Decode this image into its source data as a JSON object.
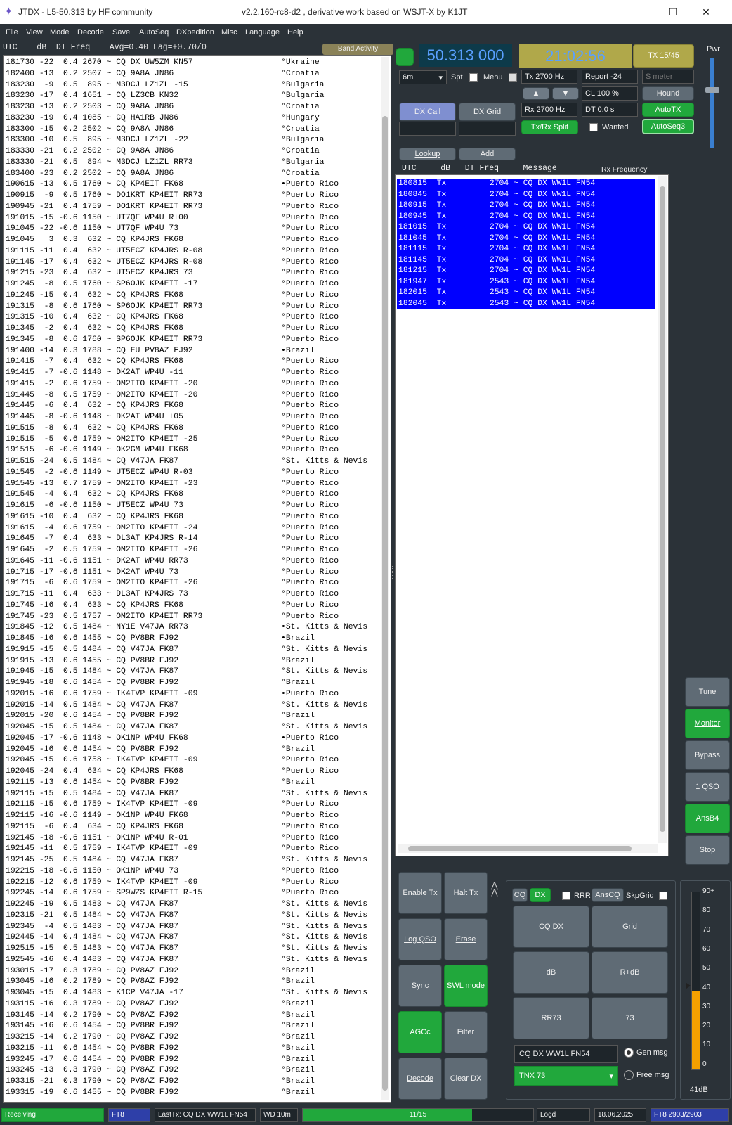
{
  "window": {
    "title": "JTDX - L5-50.313  by HF community",
    "version_text": "v2.2.160-rc8-d2 , derivative work based on WSJT-X by K1JT",
    "minimize": "—",
    "maximize": "☐",
    "close": "✕"
  },
  "menu": [
    "File",
    "View",
    "Mode",
    "Decode",
    "Save",
    "AutoSeq",
    "DXpedition",
    "Misc",
    "Language",
    "Help"
  ],
  "band_activity": {
    "header": "UTC    dB  DT Freq    Avg=0.40 Lag=+0.70/0",
    "button": "Band Activity",
    "rows": [
      [
        "181730 -22  0.4 2670 ~ CQ DX UW5ZM KN57",
        "°Ukraine"
      ],
      [
        "182400 -13  0.2 2507 ~ CQ 9A8A JN86",
        "°Croatia"
      ],
      [
        "183230  -9  0.5  895 ~ M3DCJ LZ1ZL -15",
        "°Bulgaria"
      ],
      [
        "183230 -17  0.4 1651 ~ CQ LZ3CB KN32",
        "°Bulgaria"
      ],
      [
        "183230 -13  0.2 2503 ~ CQ 9A8A JN86",
        "°Croatia"
      ],
      [
        "183230 -19  0.4 1085 ~ CQ HA1RB JN86",
        "°Hungary"
      ],
      [
        "183300 -15  0.2 2502 ~ CQ 9A8A JN86",
        "°Croatia"
      ],
      [
        "183300 -10  0.5  895 ~ M3DCJ LZ1ZL -22",
        "°Bulgaria"
      ],
      [
        "183330 -21  0.2 2502 ~ CQ 9A8A JN86",
        "°Croatia"
      ],
      [
        "183330 -21  0.5  894 ~ M3DCJ LZ1ZL RR73",
        "°Bulgaria"
      ],
      [
        "183400 -23  0.2 2502 ~ CQ 9A8A JN86",
        "°Croatia"
      ],
      [
        "190615 -13  0.5 1760 ~ CQ KP4EIT FK68",
        "•Puerto Rico"
      ],
      [
        "190915  -9  0.5 1760 ~ DO1KRT KP4EIT RR73",
        "°Puerto Rico"
      ],
      [
        "190945 -21  0.4 1759 ~ DO1KRT KP4EIT RR73",
        "°Puerto Rico"
      ],
      [
        "191015 -15 -0.6 1150 ~ UT7QF WP4U R+00",
        "°Puerto Rico"
      ],
      [
        "191045 -22 -0.6 1150 ~ UT7QF WP4U 73",
        "°Puerto Rico"
      ],
      [
        "191045   3  0.3  632 ~ CQ KP4JRS FK68",
        "°Puerto Rico"
      ],
      [
        "191115 -11  0.4  632 ~ UT5ECZ KP4JRS R-08",
        "°Puerto Rico"
      ],
      [
        "191145 -17  0.4  632 ~ UT5ECZ KP4JRS R-08",
        "°Puerto Rico"
      ],
      [
        "191215 -23  0.4  632 ~ UT5ECZ KP4JRS 73",
        "°Puerto Rico"
      ],
      [
        "191245  -8  0.5 1760 ~ SP6OJK KP4EIT -17",
        "°Puerto Rico"
      ],
      [
        "191245 -15  0.4  632 ~ CQ KP4JRS FK68",
        "°Puerto Rico"
      ],
      [
        "191315  -8  0.6 1760 ~ SP6OJK KP4EIT RR73",
        "°Puerto Rico"
      ],
      [
        "191315 -10  0.4  632 ~ CQ KP4JRS FK68",
        "°Puerto Rico"
      ],
      [
        "191345  -2  0.4  632 ~ CQ KP4JRS FK68",
        "°Puerto Rico"
      ],
      [
        "191345  -8  0.6 1760 ~ SP6OJK KP4EIT RR73",
        "°Puerto Rico"
      ],
      [
        "191400 -14  0.3 1788 ~ CQ EU PV8AZ FJ92",
        "•Brazil"
      ],
      [
        "191415  -7  0.4  632 ~ CQ KP4JRS FK68",
        "°Puerto Rico"
      ],
      [
        "191415  -7 -0.6 1148 ~ DK2AT WP4U -11",
        "°Puerto Rico"
      ],
      [
        "191415  -2  0.6 1759 ~ OM2ITO KP4EIT -20",
        "°Puerto Rico"
      ],
      [
        "191445  -8  0.5 1759 ~ OM2ITO KP4EIT -20",
        "°Puerto Rico"
      ],
      [
        "191445  -6  0.4  632 ~ CQ KP4JRS FK68",
        "°Puerto Rico"
      ],
      [
        "191445  -8 -0.6 1148 ~ DK2AT WP4U +05",
        "°Puerto Rico"
      ],
      [
        "191515  -8  0.4  632 ~ CQ KP4JRS FK68",
        "°Puerto Rico"
      ],
      [
        "191515  -5  0.6 1759 ~ OM2ITO KP4EIT -25",
        "°Puerto Rico"
      ],
      [
        "191515  -6 -0.6 1149 ~ OK2GM WP4U FK68",
        "°Puerto Rico"
      ],
      [
        "191515 -24  0.5 1484 ~ CQ V47JA FK87",
        "°St. Kitts & Nevis"
      ],
      [
        "191545  -2 -0.6 1149 ~ UT5ECZ WP4U R-03",
        "°Puerto Rico"
      ],
      [
        "191545 -13  0.7 1759 ~ OM2ITO KP4EIT -23",
        "°Puerto Rico"
      ],
      [
        "191545  -4  0.4  632 ~ CQ KP4JRS FK68",
        "°Puerto Rico"
      ],
      [
        "191615  -6 -0.6 1150 ~ UT5ECZ WP4U 73",
        "°Puerto Rico"
      ],
      [
        "191615 -10  0.4  632 ~ CQ KP4JRS FK68",
        "°Puerto Rico"
      ],
      [
        "191615  -4  0.6 1759 ~ OM2ITO KP4EIT -24",
        "°Puerto Rico"
      ],
      [
        "191645  -7  0.4  633 ~ DL3AT KP4JRS R-14",
        "°Puerto Rico"
      ],
      [
        "191645  -2  0.5 1759 ~ OM2ITO KP4EIT -26",
        "°Puerto Rico"
      ],
      [
        "191645 -11 -0.6 1151 ~ DK2AT WP4U RR73",
        "°Puerto Rico"
      ],
      [
        "191715 -17 -0.6 1151 ~ DK2AT WP4U 73",
        "°Puerto Rico"
      ],
      [
        "191715  -6  0.6 1759 ~ OM2ITO KP4EIT -26",
        "°Puerto Rico"
      ],
      [
        "191715 -11  0.4  633 ~ DL3AT KP4JRS 73",
        "°Puerto Rico"
      ],
      [
        "191745 -16  0.4  633 ~ CQ KP4JRS FK68",
        "°Puerto Rico"
      ],
      [
        "191745 -23  0.5 1757 ~ OM2ITO KP4EIT RR73",
        "°Puerto Rico"
      ],
      [
        "191845 -12  0.5 1484 ~ NY1E V47JA RR73",
        "•St. Kitts & Nevis"
      ],
      [
        "191845 -16  0.6 1455 ~ CQ PV8BR FJ92",
        "•Brazil"
      ],
      [
        "191915 -15  0.5 1484 ~ CQ V47JA FK87",
        "°St. Kitts & Nevis"
      ],
      [
        "191915 -13  0.6 1455 ~ CQ PV8BR FJ92",
        "°Brazil"
      ],
      [
        "191945 -15  0.5 1484 ~ CQ V47JA FK87",
        "°St. Kitts & Nevis"
      ],
      [
        "191945 -18  0.6 1454 ~ CQ PV8BR FJ92",
        "°Brazil"
      ],
      [
        "192015 -16  0.6 1759 ~ IK4TVP KP4EIT -09",
        "•Puerto Rico"
      ],
      [
        "192015 -14  0.5 1484 ~ CQ V47JA FK87",
        "°St. Kitts & Nevis"
      ],
      [
        "192015 -20  0.6 1454 ~ CQ PV8BR FJ92",
        "°Brazil"
      ],
      [
        "192045 -15  0.5 1484 ~ CQ V47JA FK87",
        "°St. Kitts & Nevis"
      ],
      [
        "192045 -17 -0.6 1148 ~ OK1NP WP4U FK68",
        "•Puerto Rico"
      ],
      [
        "192045 -16  0.6 1454 ~ CQ PV8BR FJ92",
        "°Brazil"
      ],
      [
        "192045 -15  0.6 1758 ~ IK4TVP KP4EIT -09",
        "°Puerto Rico"
      ],
      [
        "192045 -24  0.4  634 ~ CQ KP4JRS FK68",
        "°Puerto Rico"
      ],
      [
        "192115 -13  0.6 1454 ~ CQ PV8BR FJ92",
        "°Brazil"
      ],
      [
        "192115 -15  0.5 1484 ~ CQ V47JA FK87",
        "°St. Kitts & Nevis"
      ],
      [
        "192115 -15  0.6 1759 ~ IK4TVP KP4EIT -09",
        "°Puerto Rico"
      ],
      [
        "192115 -16 -0.6 1149 ~ OK1NP WP4U FK68",
        "°Puerto Rico"
      ],
      [
        "192115  -6  0.4  634 ~ CQ KP4JRS FK68",
        "°Puerto Rico"
      ],
      [
        "192145 -18 -0.6 1151 ~ OK1NP WP4U R-01",
        "°Puerto Rico"
      ],
      [
        "192145 -11  0.5 1759 ~ IK4TVP KP4EIT -09",
        "°Puerto Rico"
      ],
      [
        "192145 -25  0.5 1484 ~ CQ V47JA FK87",
        "°St. Kitts & Nevis"
      ],
      [
        "192215 -18 -0.6 1150 ~ OK1NP WP4U 73",
        "°Puerto Rico"
      ],
      [
        "192215 -12  0.6 1759 ~ IK4TVP KP4EIT -09",
        "°Puerto Rico"
      ],
      [
        "192245 -14  0.6 1759 ~ SP9WZS KP4EIT R-15",
        "°Puerto Rico"
      ],
      [
        "192245 -19  0.5 1483 ~ CQ V47JA FK87",
        "°St. Kitts & Nevis"
      ],
      [
        "192315 -21  0.5 1484 ~ CQ V47JA FK87",
        "°St. Kitts & Nevis"
      ],
      [
        "192345  -4  0.5 1483 ~ CQ V47JA FK87",
        "°St. Kitts & Nevis"
      ],
      [
        "192445 -14  0.4 1484 ~ CQ V47JA FK87",
        "°St. Kitts & Nevis"
      ],
      [
        "192515 -15  0.5 1483 ~ CQ V47JA FK87",
        "°St. Kitts & Nevis"
      ],
      [
        "192545 -16  0.4 1483 ~ CQ V47JA FK87",
        "°St. Kitts & Nevis"
      ],
      [
        "193015 -17  0.3 1789 ~ CQ PV8AZ FJ92",
        "°Brazil"
      ],
      [
        "193045 -16  0.2 1789 ~ CQ PV8AZ FJ92",
        "°Brazil"
      ],
      [
        "193045 -15  0.4 1483 ~ K1CP V47JA -17",
        "°St. Kitts & Nevis"
      ],
      [
        "193115 -16  0.3 1789 ~ CQ PV8AZ FJ92",
        "°Brazil"
      ],
      [
        "193145 -14  0.2 1790 ~ CQ PV8AZ FJ92",
        "°Brazil"
      ],
      [
        "193145 -16  0.6 1454 ~ CQ PV8BR FJ92",
        "°Brazil"
      ],
      [
        "193215 -14  0.2 1790 ~ CQ PV8AZ FJ92",
        "°Brazil"
      ],
      [
        "193215 -11  0.6 1454 ~ CQ PV8BR FJ92",
        "°Brazil"
      ],
      [
        "193245 -17  0.6 1454 ~ CQ PV8BR FJ92",
        "°Brazil"
      ],
      [
        "193245 -13  0.3 1790 ~ CQ PV8AZ FJ92",
        "°Brazil"
      ],
      [
        "193315 -21  0.3 1790 ~ CQ PV8AZ FJ92",
        "°Brazil"
      ],
      [
        "193315 -19  0.6 1455 ~ CQ PV8BR FJ92",
        "°Brazil"
      ]
    ]
  },
  "top_controls": {
    "frequency": "50.313 000",
    "clock": "21:02:56",
    "tx_counter": "TX 15/45",
    "band": "6m",
    "spt": "Spt",
    "menu": "Menu",
    "tx_freq": "Tx  2700  Hz",
    "report": "Report -24",
    "s_meter": "S meter",
    "cl": "CL  100 %",
    "hound": "Hound",
    "up": "▲",
    "down": "▼",
    "rx_freq": "Rx  2700  Hz",
    "dt": "DT  0.0 s",
    "autotx": "AutoTX",
    "dx_call": "DX Call",
    "dx_grid": "DX Grid",
    "tx_rx_split": "Tx/Rx Split",
    "wanted": "Wanted",
    "autoseq3": "AutoSeq3",
    "lookup": "Lookup",
    "add": "Add",
    "pwr": "Pwr"
  },
  "rx_freq_window": {
    "header_cols": "UTC     dB   DT Freq     Message",
    "header_title": "Rx Frequency",
    "rows": [
      "180815  Tx         2704 ~ CQ DX WW1L FN54",
      "180845  Tx         2704 ~ CQ DX WW1L FN54",
      "180915  Tx         2704 ~ CQ DX WW1L FN54",
      "180945  Tx         2704 ~ CQ DX WW1L FN54",
      "181015  Tx         2704 ~ CQ DX WW1L FN54",
      "181045  Tx         2704 ~ CQ DX WW1L FN54",
      "181115  Tx         2704 ~ CQ DX WW1L FN54",
      "181145  Tx         2704 ~ CQ DX WW1L FN54",
      "181215  Tx         2704 ~ CQ DX WW1L FN54",
      "181947  Tx         2543 ~ CQ DX WW1L FN54",
      "182015  Tx         2543 ~ CQ DX WW1L FN54",
      "182045  Tx         2543 ~ CQ DX WW1L FN54"
    ]
  },
  "side_buttons": [
    "Tune",
    "Monitor",
    "Bypass",
    "1 QSO",
    "AnsB4",
    "Stop"
  ],
  "bottom_buttons": {
    "enable_tx": "Enable Tx",
    "halt_tx": "Halt Tx",
    "log_qso": "Log QSO",
    "erase": "Erase",
    "sync": "Sync",
    "swl_mode": "SWL mode",
    "agcc": "AGCc",
    "filter": "Filter",
    "decode": "Decode",
    "clear_dx": "Clear DX"
  },
  "tx_messages": {
    "cq": "CQ",
    "dx": "DX",
    "rrr": "RRR",
    "anscq": "AnsCQ",
    "skpgrid": "SkpGrid",
    "cq_dx": "CQ DX",
    "grid": "Grid",
    "db": "dB",
    "r_db": "R+dB",
    "rr73": "RR73",
    "seventy_three": "73",
    "gen_text": "CQ DX WW1L FN54",
    "gen_msg": "Gen msg",
    "free_text": "TNX 73",
    "free_msg": "Free msg"
  },
  "signal_meter": {
    "ticks": [
      "90+",
      "80",
      "70",
      "60",
      "50",
      "40",
      "30",
      "20",
      "10",
      "0"
    ],
    "value_label": "41dB",
    "level": 41
  },
  "statusbar": {
    "state": "Receiving",
    "mode": "FT8",
    "last_tx": "LastTx: CQ DX WW1L FN54",
    "wd": "WD 10m",
    "progress_text": "11/15",
    "progress": 0.7333,
    "logd": "Logd",
    "date": "18.06.2025",
    "decodes": "FT8  2903/2903"
  },
  "colors": {
    "accent_green": "#21a83c",
    "freq_display_bg": "#0d3a4a",
    "freq_text": "#5aa0ff",
    "clock_bg": "#b0a84a",
    "tx_blue": "#0000ff",
    "meter_orange": "#f5a000"
  }
}
